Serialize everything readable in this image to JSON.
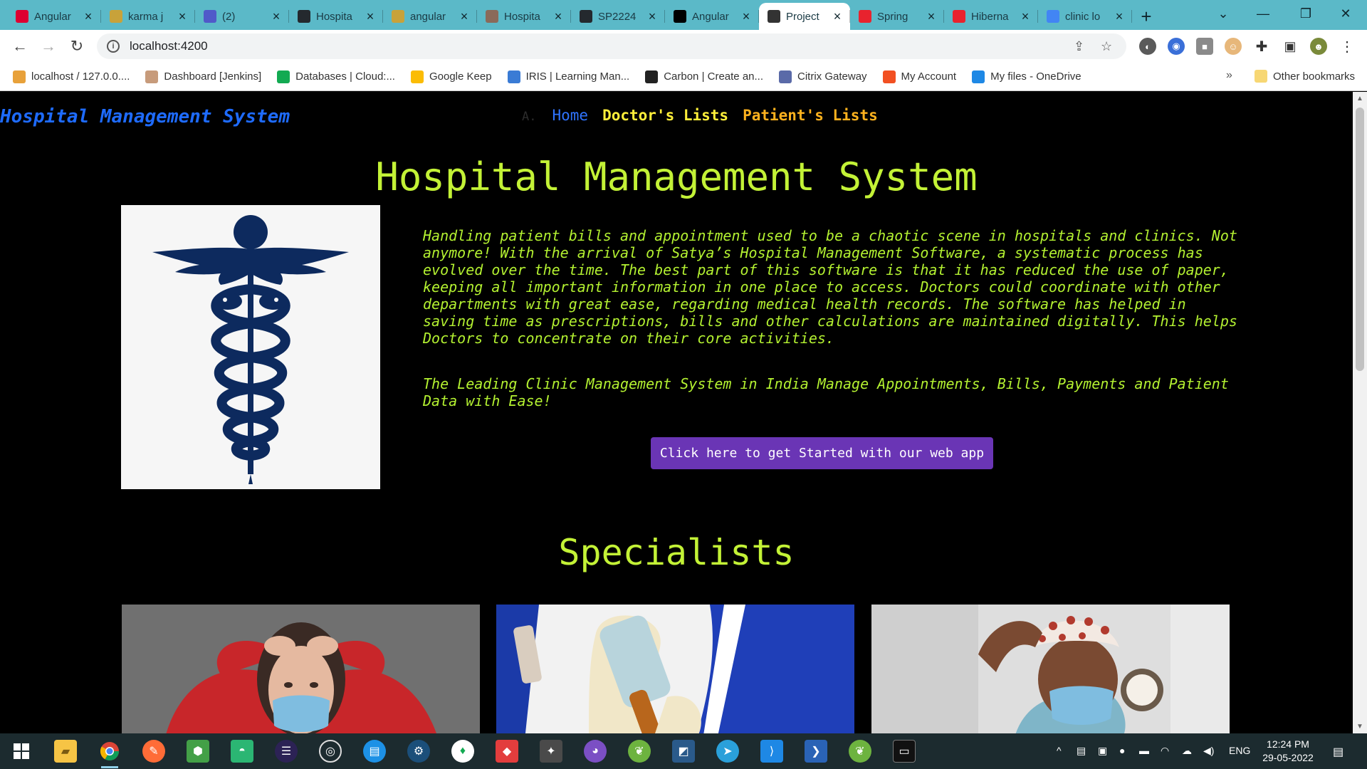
{
  "browser": {
    "tabs": [
      {
        "title": "Angular",
        "icon": "angular-icon",
        "color": "#dd0031"
      },
      {
        "title": "karma j",
        "icon": "karma-icon",
        "color": "#c8a23a"
      },
      {
        "title": "(2)",
        "icon": "teams-icon",
        "color": "#5059c9"
      },
      {
        "title": "Hospita",
        "icon": "github-icon",
        "color": "#24292e"
      },
      {
        "title": "angular",
        "icon": "karma-icon",
        "color": "#c8a23a"
      },
      {
        "title": "Hospita",
        "icon": "avatar-icon",
        "color": "#8a6a5a"
      },
      {
        "title": "SP2224",
        "icon": "github-icon",
        "color": "#24292e"
      },
      {
        "title": "Angular",
        "icon": "medium-icon",
        "color": "#000000"
      },
      {
        "title": "Project",
        "icon": "angular-icon",
        "color": "#333333"
      },
      {
        "title": "Spring",
        "icon": "vivaldi-icon",
        "color": "#e8232e"
      },
      {
        "title": "Hiberna",
        "icon": "vivaldi-icon",
        "color": "#e8232e"
      },
      {
        "title": "clinic lo",
        "icon": "google-icon",
        "color": "#4285f4"
      }
    ],
    "active_tab_index": 8,
    "address": "localhost:4200",
    "bookmarks": [
      {
        "label": "localhost / 127.0.0....",
        "color": "#e8a13a"
      },
      {
        "label": "Dashboard [Jenkins]",
        "color": "#c79b7b"
      },
      {
        "label": "Databases | Cloud:...",
        "color": "#13aa52"
      },
      {
        "label": "Google Keep",
        "color": "#fbbc04"
      },
      {
        "label": "IRIS | Learning Man...",
        "color": "#3a7bd5"
      },
      {
        "label": "Carbon | Create an...",
        "color": "#222222"
      },
      {
        "label": "Citrix Gateway",
        "color": "#5a6aa8"
      },
      {
        "label": "My Account",
        "color": "#f25022"
      },
      {
        "label": "My files - OneDrive",
        "color": "#1e88e5"
      }
    ],
    "other_bookmarks": "Other bookmarks"
  },
  "page": {
    "brand": "Hospital Management System",
    "nav": {
      "brandmark": "A.",
      "home": "Home",
      "doctors": "Doctor's Lists",
      "patients": "Patient's Lists"
    },
    "hero_title": "Hospital Management System",
    "description": "Handling patient bills and appointment used to be a chaotic scene in hospitals and clinics. Not anymore! With the arrival of Satya’s Hospital Management Software, a systematic process has evolved over the time. The best part of this software is that it has reduced the use of paper, keeping all important information in one place to access. Doctors could coordinate with other departments with great ease, regarding medical health records. The software has helped in saving time as prescriptions, bills and other calculations are maintained digitally. This helps Doctors to concentrate on their core activities.",
    "tagline": "The Leading Clinic Management System in India Manage Appointments, Bills, Payments and Patient Data with Ease!",
    "cta_label": "Click here to get Started with our web app",
    "specialists_title": "Specialists",
    "colors": {
      "headline": "#c3f236",
      "body_text": "#b4f231",
      "brand": "#1e6bff",
      "cta": "#6a35b5",
      "logo": "#0d2a5e"
    }
  },
  "taskbar": {
    "time": "12:24 PM",
    "date": "29-05-2022",
    "lang": "ENG"
  }
}
